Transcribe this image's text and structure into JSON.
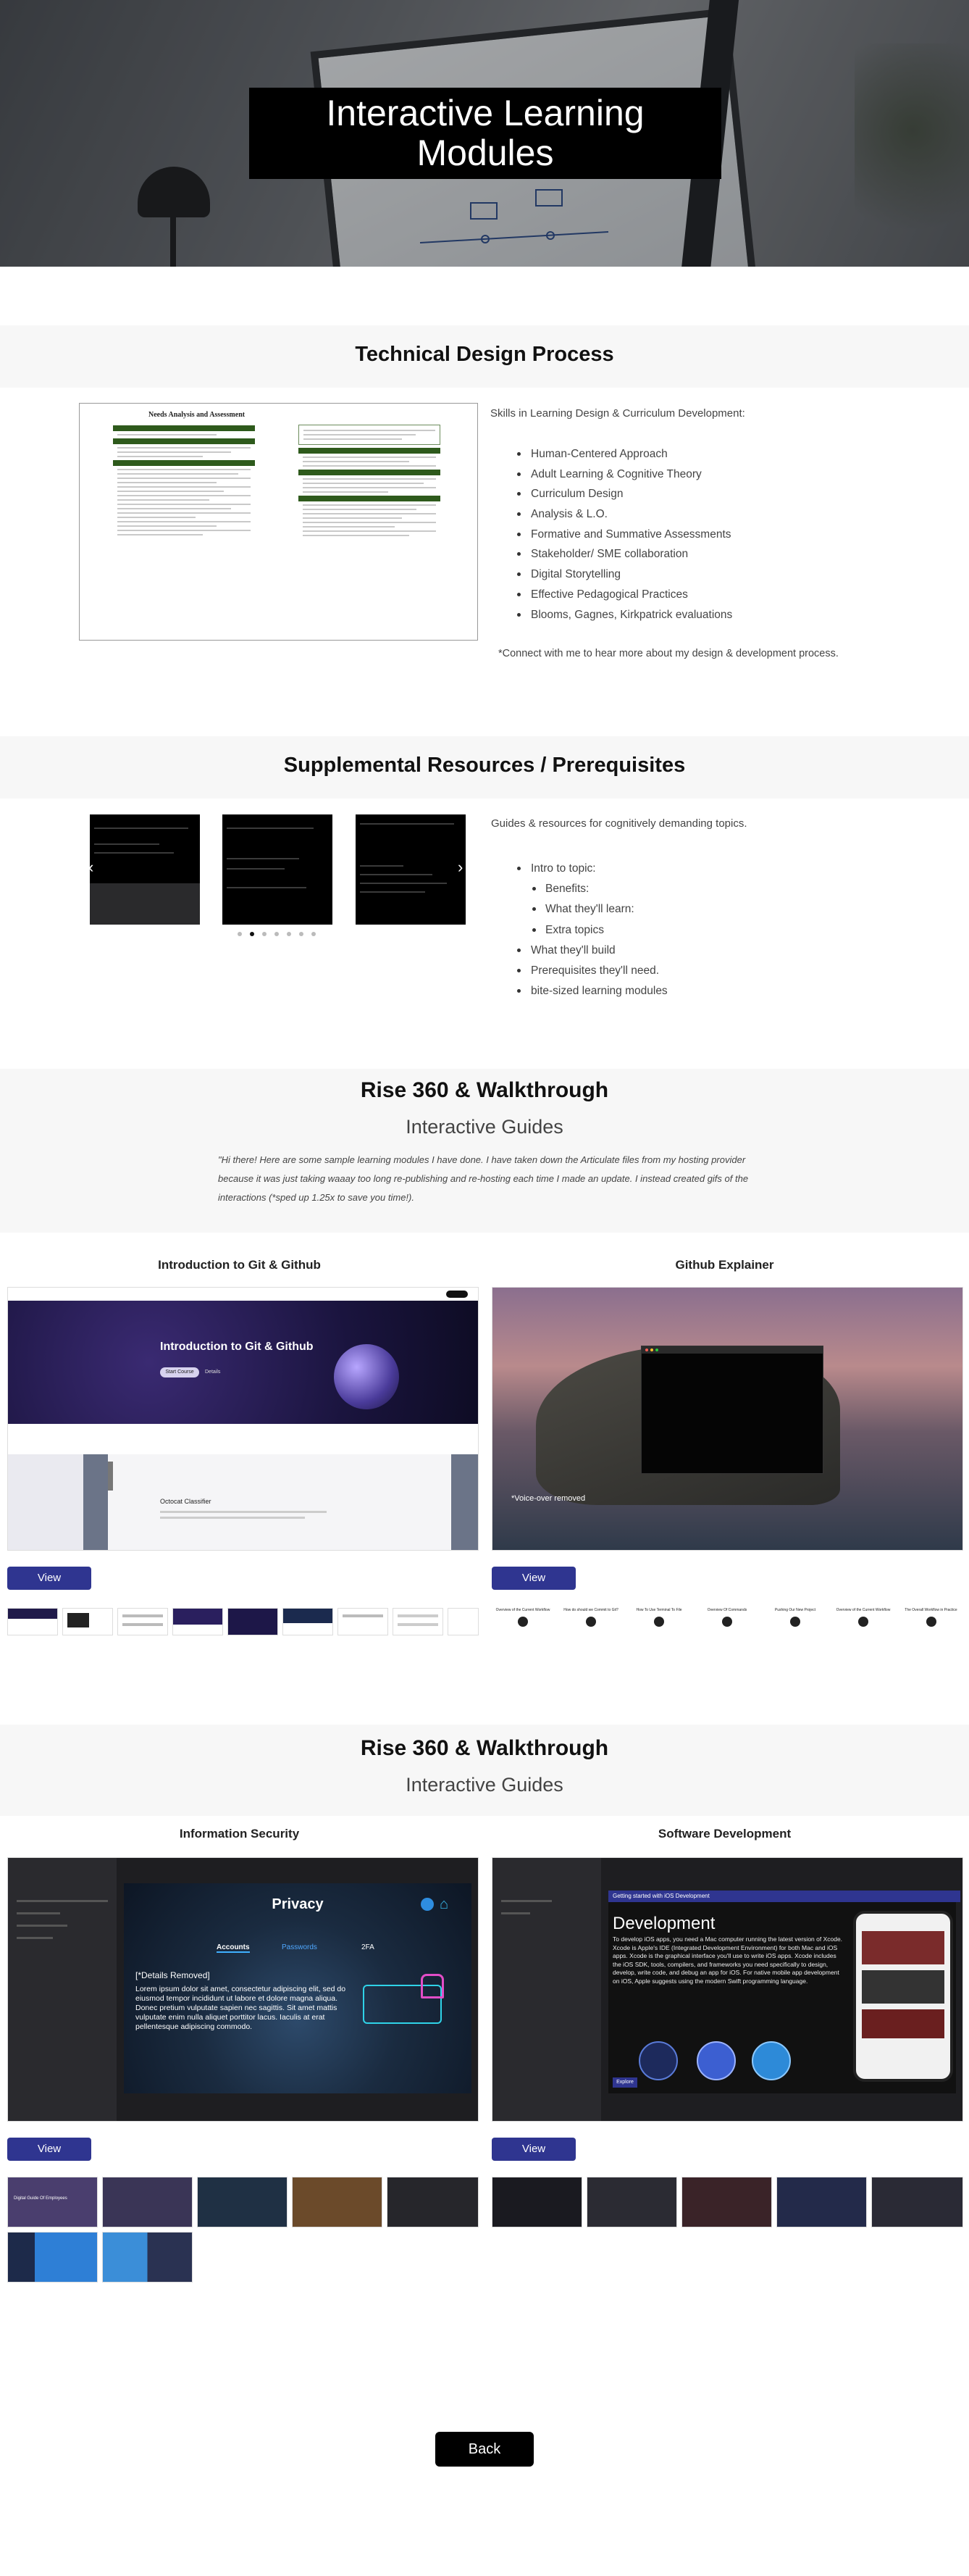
{
  "hero": {
    "title": "Interactive Learning\nModules"
  },
  "technical": {
    "heading": "Technical Design Process",
    "doc_title": "Needs Analysis and Assessment",
    "skills_intro": "Skills in Learning Design & Curriculum Development:",
    "skills": [
      "Human-Centered Approach",
      "Adult Learning  & Cognitive Theory",
      "Curriculum Design",
      "Analysis & L.O.",
      "Formative and Summative Assessments",
      "Stakeholder/ SME collaboration",
      "Digital Storytelling",
      "Effective Pedagogical Practices",
      "Blooms, Gagnes, Kirkpatrick evaluations"
    ],
    "connect": "*Connect with me to hear more about my design & development process."
  },
  "supplemental": {
    "heading": "Supplemental Resources / Prerequisites",
    "intro": "Guides & resources for cognitively demanding topics.",
    "items": [
      {
        "text": "Intro to topic:",
        "sub": false
      },
      {
        "text": "Benefits:",
        "sub": true
      },
      {
        "text": "What they'll learn:",
        "sub": true
      },
      {
        "text": "Extra topics",
        "sub": true
      },
      {
        "text": "What they'll build",
        "sub": false
      },
      {
        "text": "Prerequisites they'll need.",
        "sub": false
      },
      {
        "text": "bite-sized learning modules",
        "sub": false
      }
    ],
    "carousel": {
      "prev_icon": "chevron-left-icon",
      "next_icon": "chevron-right-icon",
      "dot_count": 7,
      "active_dot": 1
    }
  },
  "rise1": {
    "heading": "Rise 360 & Walkthrough",
    "subheading": "Interactive Guides",
    "quote": "\"Hi there! Here are some sample learning modules I have done. I have taken down the Articulate files from my hosting provider because it was just taking waaay too long re-publishing and re-hosting each time I made an update. I instead created gifs of the interactions (*sped up 1.25x to save you time!).",
    "cards": [
      {
        "title": "Introduction to Git & Github",
        "button": "View",
        "inner_title": "Introduction to Git & Github",
        "inner_btn1": "Start Course",
        "inner_btn2": "Details",
        "classifier": "Octocat Classifier"
      },
      {
        "title": "Github Explainer",
        "button": "View",
        "overlay": "*Voice-over removed",
        "thumb_labels": [
          "Overview of the Current Workflow",
          "How do should we Commit to Git?",
          "How To Use Terminal To File",
          "Overview Of Commands",
          "Pushing Our New Project",
          "Overview of the Current Workflow",
          "The Overall Workflow in Practice"
        ]
      }
    ]
  },
  "rise2": {
    "heading": "Rise 360 & Walkthrough",
    "subheading": "Interactive Guides",
    "cards": [
      {
        "title": "Information Security",
        "button": "View",
        "panel_title": "Privacy",
        "tab_active": "Accounts",
        "tab_other": "Passwords",
        "tab_third": "2FA",
        "details": "[*Details Removed]",
        "lorem": "Lorem ipsum dolor sit amet, consectetur adipiscing elit, sed do eiusmod tempor incididunt ut labore et dolore magna aliqua. Donec pretium vulputate sapien nec sagittis. Sit amet mattis vulputate enim nulla aliquet porttitor lacus. Iaculis at erat pellentesque adipiscing commodo.",
        "thumb_text": "Digital Guide Of Employees"
      },
      {
        "title": "Software Development",
        "button": "View",
        "banner": "Getting started with iOS Development",
        "panel_title": "Development",
        "body": "To develop iOS apps, you need a Mac computer running the latest version of Xcode. Xcode is Apple's IDE (Integrated Development Environment) for both Mac and iOS apps. Xcode is the graphical interface you'll use to write iOS apps. Xcode includes the iOS SDK, tools, compilers, and frameworks you need specifically to design, develop, write code, and debug an app for iOS. For native mobile app development on iOS, Apple suggests using the modern Swift programming language.",
        "explore": "Explore"
      }
    ]
  },
  "footer": {
    "back": "Back"
  }
}
